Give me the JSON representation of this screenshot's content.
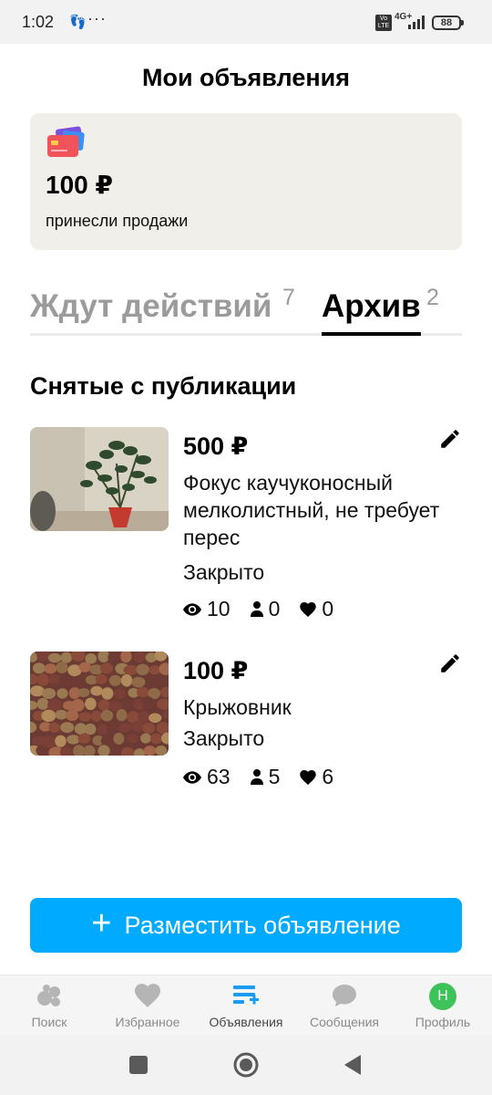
{
  "status_bar": {
    "time": "1:02",
    "volte": "Vo LTE",
    "network": "4G+",
    "battery": "88"
  },
  "header": {
    "title": "Мои объявления"
  },
  "sales_card": {
    "amount": "100 ₽",
    "caption": "принесли продажи"
  },
  "tabs": [
    {
      "label": "Ждут действий",
      "count": "7",
      "active": false
    },
    {
      "label": "Архив",
      "count": "2",
      "active": true
    }
  ],
  "section_title": "Снятые с публикации",
  "listings": [
    {
      "price": "500 ₽",
      "title": "Фокус каучуконосный мелколистный, не требует перес",
      "status": "Закрыто",
      "views": "10",
      "contacts": "0",
      "favorites": "0"
    },
    {
      "price": "100 ₽",
      "title": "Крыжовник",
      "status": "Закрыто",
      "views": "63",
      "contacts": "5",
      "favorites": "6"
    }
  ],
  "cta": {
    "label": "Разместить объявление"
  },
  "bottom_nav": [
    {
      "label": "Поиск",
      "icon": "search-icon"
    },
    {
      "label": "Избранное",
      "icon": "heart-icon"
    },
    {
      "label": "Объявления",
      "icon": "listings-icon",
      "active": true
    },
    {
      "label": "Сообщения",
      "icon": "chat-icon"
    },
    {
      "label": "Профиль",
      "icon": "avatar",
      "avatar_letter": "Н"
    }
  ],
  "colors": {
    "accent": "#00aaff",
    "card_bg": "#f1efea",
    "avatar": "#3ec35a",
    "inactive_tab": "#9b9b9b"
  }
}
